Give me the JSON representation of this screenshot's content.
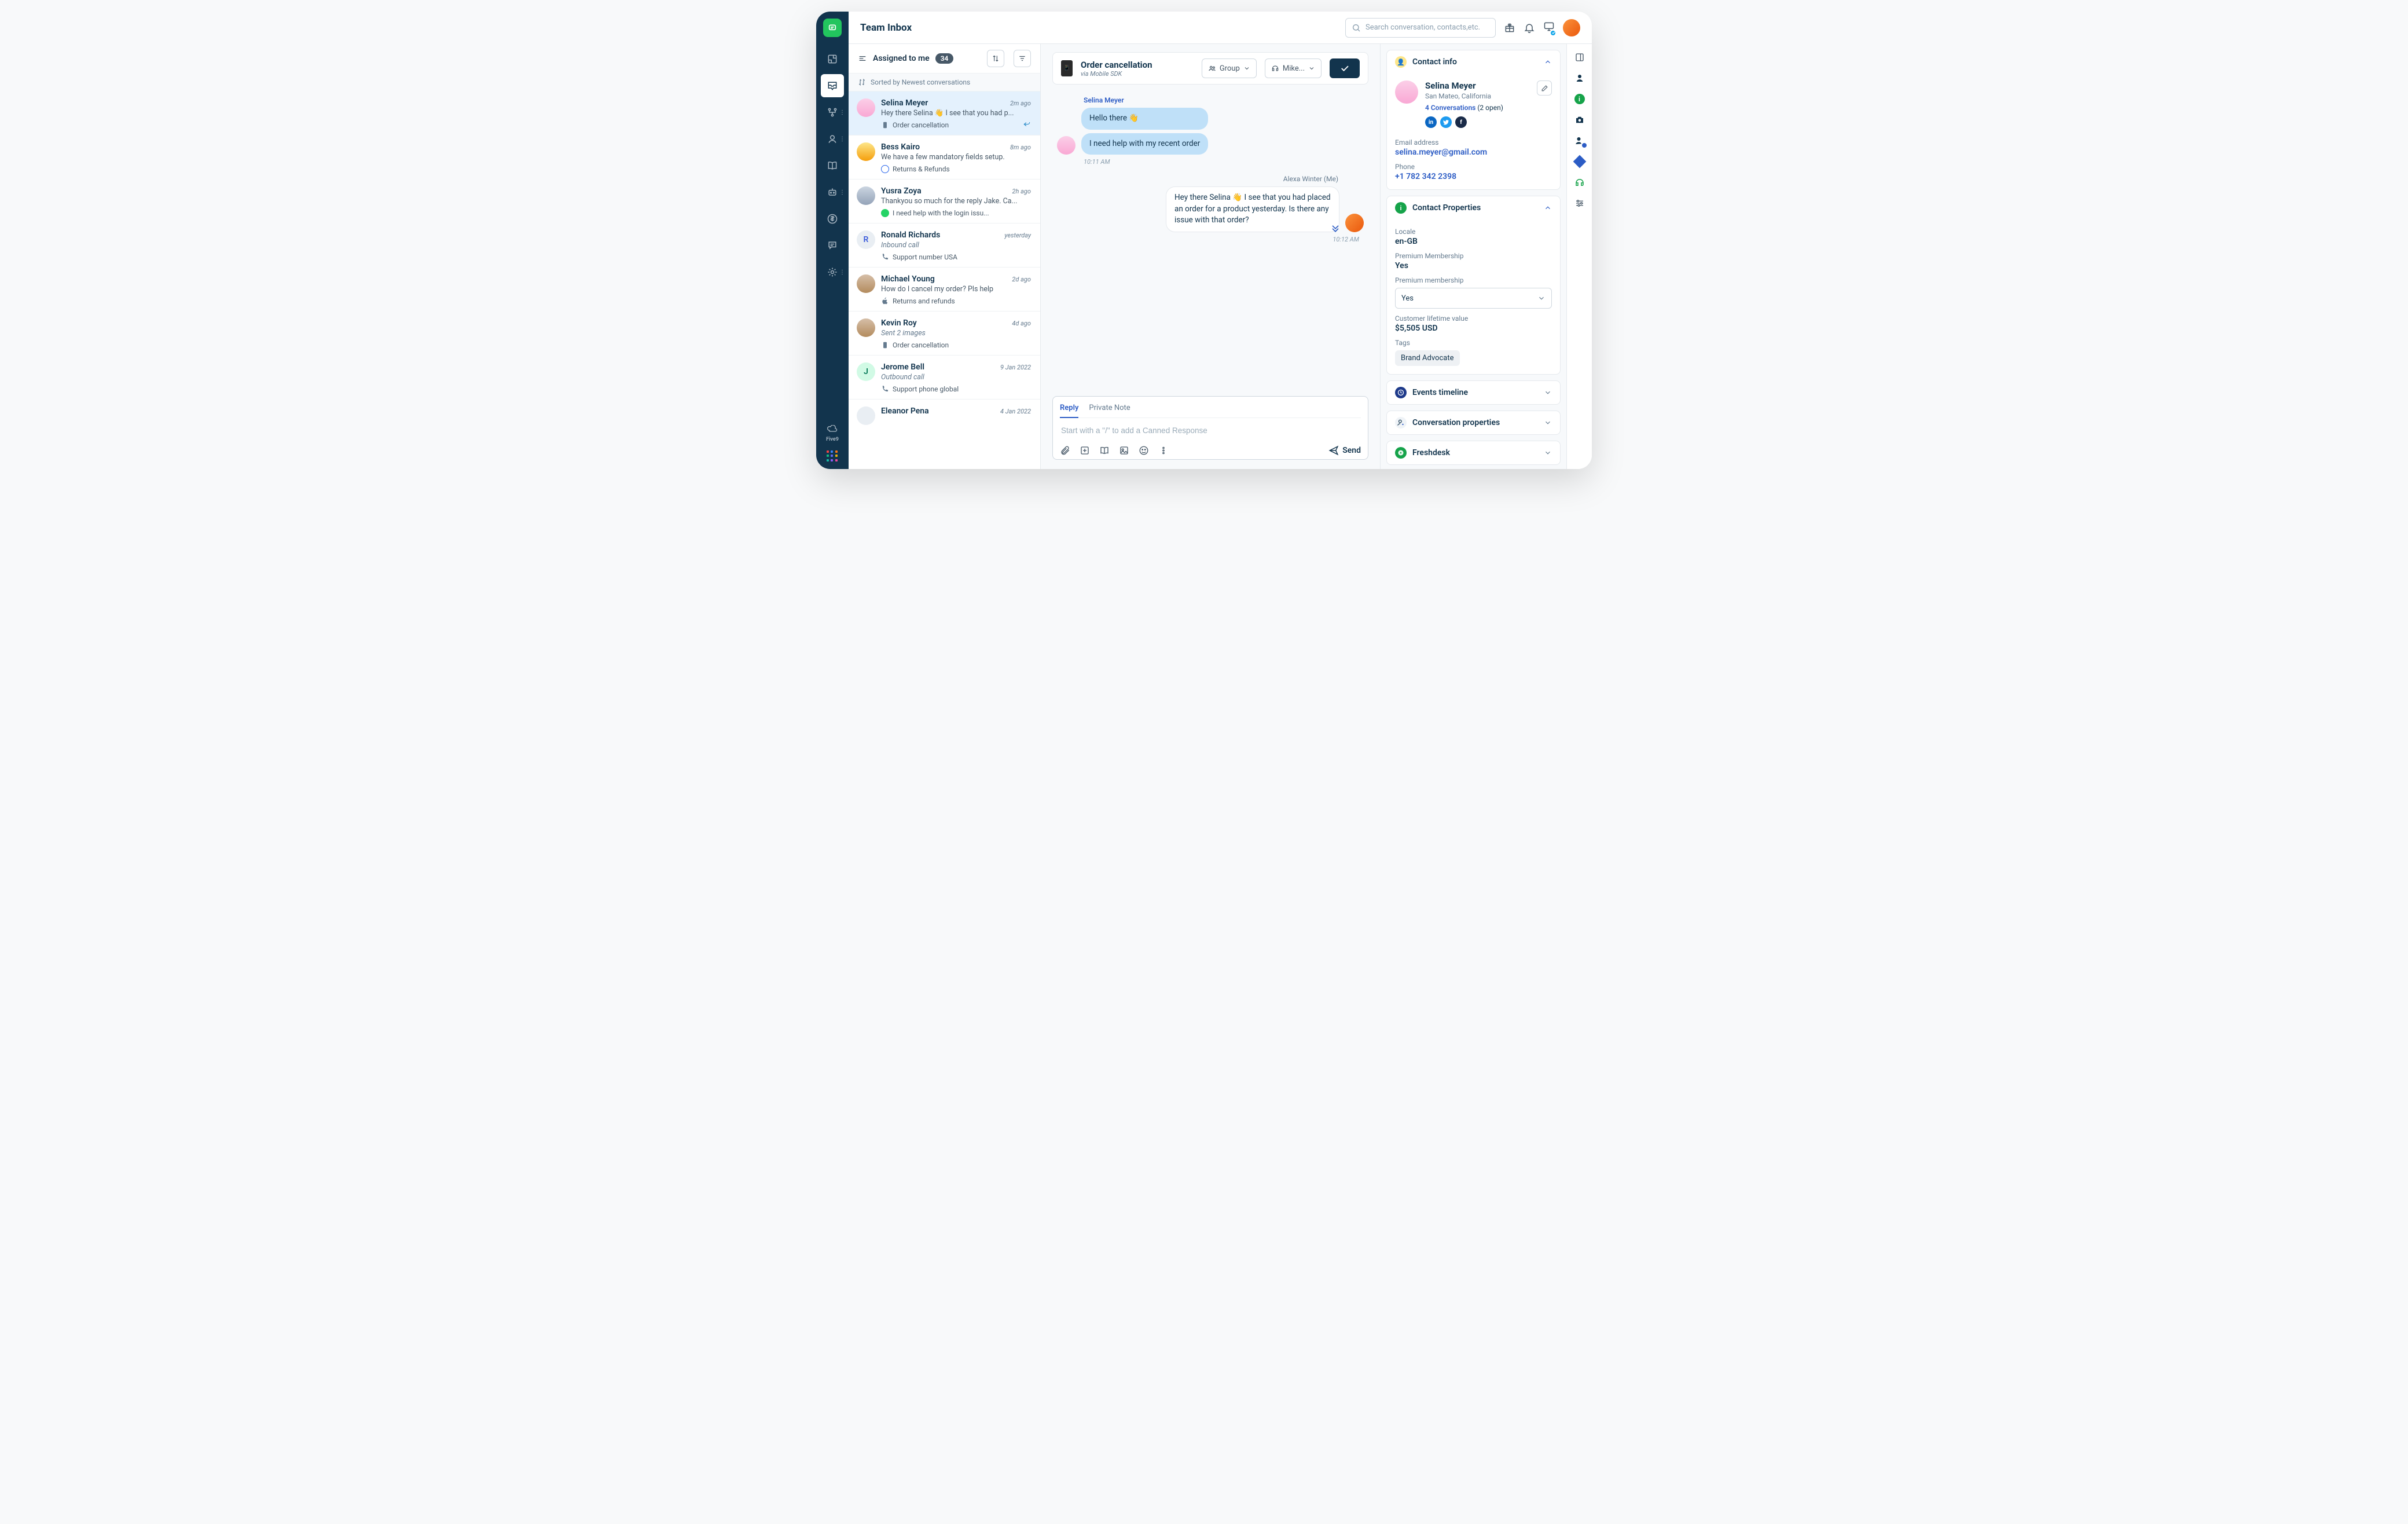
{
  "header": {
    "title": "Team Inbox",
    "search_placeholder": "Search conversation, contacts,etc."
  },
  "inbox": {
    "view_label": "Assigned to me",
    "view_count": "34",
    "sort_label": "Sorted by Newest conversations",
    "items": [
      {
        "name": "Selina Meyer",
        "time": "2m ago",
        "preview": "Hey there Selina 👋 I see that you had p...",
        "topic": "Order cancellation",
        "channel": "mobile",
        "selected": true,
        "replied": true
      },
      {
        "name": "Bess Kairo",
        "time": "8m ago",
        "preview": "We have a few mandatory fields setup.",
        "topic": "Returns & Refunds",
        "channel": "web"
      },
      {
        "name": "Yusra Zoya",
        "time": "2h ago",
        "preview": "Thankyou so much for the reply Jake. Ca...",
        "topic": "I need help with the login issu...",
        "channel": "whatsapp"
      },
      {
        "name": "Ronald Richards",
        "time": "yesterday",
        "preview": "Inbound call",
        "preview_italic": true,
        "topic": "Support number USA",
        "channel": "phone",
        "initial": "R"
      },
      {
        "name": "Michael Young",
        "time": "2d ago",
        "preview": "How do I cancel my order? Pls help",
        "topic": "Returns and refunds",
        "channel": "apple"
      },
      {
        "name": "Kevin Roy",
        "time": "4d ago",
        "preview": "Sent 2 images",
        "preview_italic": true,
        "topic": "Order cancellation",
        "channel": "mobile"
      },
      {
        "name": "Jerome Bell",
        "time": "9 Jan 2022",
        "preview": "Outbound call",
        "preview_italic": true,
        "topic": "Support phone global",
        "channel": "phone",
        "initial": "J"
      },
      {
        "name": "Eleanor Pena",
        "time": "4 Jan 2022",
        "preview": "",
        "topic": "",
        "channel": ""
      }
    ]
  },
  "conversation": {
    "title": "Order cancellation",
    "subtitle": "via Mobile SDK",
    "group_label": "Group",
    "assignee_label": "Mike...",
    "inbound": {
      "sender": "Selina Meyer",
      "bubbles": [
        "Hello there 👋",
        "I need help with my recent order"
      ],
      "time": "10:11 AM"
    },
    "outbound": {
      "sender": "Alexa Winter (Me)",
      "text": "Hey there Selina 👋 I see that you had placed an order for a product yesterday. Is there any issue with that order?",
      "time": "10:12 AM"
    }
  },
  "composer": {
    "tab_reply": "Reply",
    "tab_note": "Private Note",
    "placeholder": "Start with a \"/\" to add a Canned Response",
    "send_label": "Send"
  },
  "contact": {
    "panel_title": "Contact info",
    "name": "Selina Meyer",
    "location": "San Mateo, California",
    "conversations_link": "4 Conversations",
    "conversations_open": "(2 open)",
    "email_label": "Email address",
    "email": "selina.meyer@gmail.com",
    "phone_label": "Phone",
    "phone": "+1 782 342 2398"
  },
  "properties": {
    "panel_title": "Contact Properties",
    "locale_label": "Locale",
    "locale": "en-GB",
    "premium_label": "Premium Membership",
    "premium": "Yes",
    "premium2_label": "Premium membership",
    "premium2": "Yes",
    "clv_label": "Customer lifetime value",
    "clv": "$5,505 USD",
    "tags_label": "Tags",
    "tag": "Brand Advocate"
  },
  "panels": {
    "events": "Events timeline",
    "conv_props": "Conversation properties",
    "freshdesk": "Freshdesk"
  }
}
